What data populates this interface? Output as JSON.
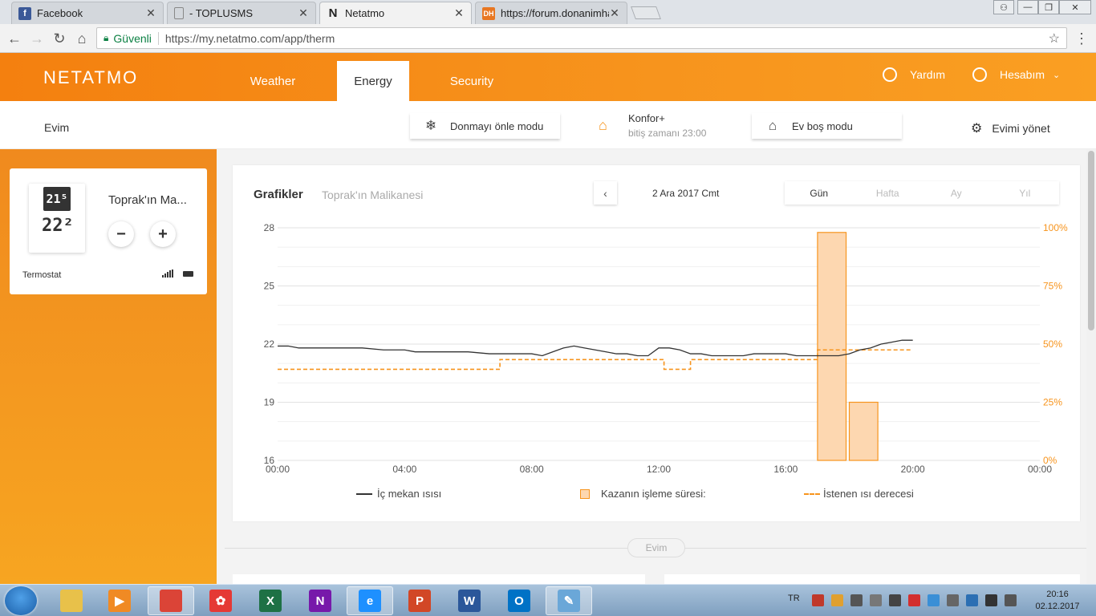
{
  "browser": {
    "tabs": [
      {
        "label": "Facebook",
        "favicon": "f",
        "color": "#3b5998"
      },
      {
        "label": "- TOPLUSMS",
        "favicon": "doc",
        "color": "#888888"
      },
      {
        "label": "Netatmo",
        "favicon": "N",
        "color": "#222222"
      },
      {
        "label": "https://forum.donanimha",
        "favicon": "DH",
        "color": "#e87722"
      }
    ],
    "active_tab": 2,
    "secure_label": "Güvenli",
    "url": "https://my.netatmo.com/app/therm"
  },
  "header": {
    "logo": "NETATMO",
    "nav": [
      "Weather",
      "Energy",
      "Security"
    ],
    "active_nav": 1,
    "help": "Yardım",
    "account": "Hesabım"
  },
  "modebar": {
    "home": "Evim",
    "frost_mode": "Donmayı önle modu",
    "comfort_title": "Konfor+",
    "comfort_sub": "bitiş zamanı 23:00",
    "away_mode": "Ev boş modu",
    "manage": "Evimi yönet"
  },
  "thermostat": {
    "current_temp": "21⁵",
    "set_temp": "22²",
    "room": "Toprak'ın Ma...",
    "device": "Termostat",
    "minus": "−",
    "plus": "+",
    "signal_level": 4
  },
  "graph": {
    "title": "Grafikler",
    "subtitle": "Toprak'ın Malikanesi",
    "date": "2 Ara 2017 Cmt",
    "ranges": [
      "Gün",
      "Hafta",
      "Ay",
      "Yıl"
    ],
    "selected_range": 0,
    "legend": [
      "İç mekan ısısı",
      "Kazanın işleme süresi:",
      "İstenen ısı derecesi"
    ],
    "footer_pill": "Evim"
  },
  "chart_data": {
    "type": "line",
    "x_ticks": [
      "00:00",
      "04:00",
      "08:00",
      "12:00",
      "16:00",
      "20:00",
      "00:00"
    ],
    "y_left_ticks": [
      28,
      25,
      22,
      19,
      16
    ],
    "y_right_ticks": [
      "100%",
      "75%",
      "50%",
      "25%",
      "0%"
    ],
    "y_left_range": [
      16,
      28
    ],
    "y_right_range": [
      0,
      100
    ],
    "colors": {
      "indoor": "#333333",
      "setpoint": "#f7941d",
      "boiler": "#f7941d"
    },
    "series": [
      {
        "name": "İç mekan ısısı",
        "x": [
          "00:00",
          "00:20",
          "00:40",
          "01:20",
          "02:00",
          "02:40",
          "03:20",
          "04:00",
          "04:20",
          "04:40",
          "05:20",
          "06:00",
          "06:40",
          "07:20",
          "08:00",
          "08:20",
          "08:40",
          "09:00",
          "09:20",
          "09:40",
          "10:00",
          "10:20",
          "10:40",
          "11:00",
          "11:20",
          "11:40",
          "12:00",
          "12:20",
          "12:40",
          "13:00",
          "13:20",
          "13:40",
          "14:00",
          "14:40",
          "15:00",
          "15:20",
          "15:40",
          "16:00",
          "16:20",
          "16:40",
          "17:00",
          "17:20",
          "17:40",
          "18:00",
          "18:20",
          "18:40",
          "19:00",
          "19:20",
          "19:40",
          "20:00"
        ],
        "values": [
          21.9,
          21.9,
          21.8,
          21.8,
          21.8,
          21.8,
          21.7,
          21.7,
          21.6,
          21.6,
          21.6,
          21.6,
          21.5,
          21.5,
          21.5,
          21.4,
          21.6,
          21.8,
          21.9,
          21.8,
          21.7,
          21.6,
          21.5,
          21.5,
          21.4,
          21.4,
          21.8,
          21.8,
          21.7,
          21.5,
          21.5,
          21.4,
          21.4,
          21.4,
          21.5,
          21.5,
          21.5,
          21.5,
          21.4,
          21.4,
          21.4,
          21.4,
          21.4,
          21.5,
          21.7,
          21.8,
          22.0,
          22.1,
          22.2,
          22.2
        ]
      },
      {
        "name": "İstenen ısı derecesi",
        "x": [
          "00:00",
          "07:00",
          "07:00",
          "12:10",
          "12:10",
          "13:00",
          "13:00",
          "17:00",
          "17:00",
          "20:00"
        ],
        "values": [
          20.7,
          20.7,
          21.2,
          21.2,
          20.7,
          20.7,
          21.2,
          21.2,
          21.7,
          21.7
        ]
      },
      {
        "name": "Kazanın işleme süresi:",
        "x": [
          "17:00",
          "18:00"
        ],
        "values": [
          98,
          25
        ],
        "kind": "bar_percent"
      }
    ]
  },
  "taskbar": {
    "apps": [
      {
        "name": "file-explorer",
        "color": "#e8c14a",
        "glyph": ""
      },
      {
        "name": "media-player",
        "color": "#f08a24",
        "glyph": "▶"
      },
      {
        "name": "chrome",
        "color": "#db4437",
        "glyph": "",
        "open": true
      },
      {
        "name": "photo-app",
        "color": "#e53935",
        "glyph": "✿"
      },
      {
        "name": "excel",
        "color": "#1e7145",
        "glyph": "X"
      },
      {
        "name": "onenote",
        "color": "#7719aa",
        "glyph": "N"
      },
      {
        "name": "internet-explorer",
        "color": "#1e90ff",
        "glyph": "e",
        "open": true
      },
      {
        "name": "powerpoint",
        "color": "#d24726",
        "glyph": "P"
      },
      {
        "name": "word",
        "color": "#2b579a",
        "glyph": "W"
      },
      {
        "name": "outlook",
        "color": "#0072c6",
        "glyph": "O"
      },
      {
        "name": "paint",
        "color": "#6aa7d8",
        "glyph": "✎",
        "open": true
      }
    ],
    "lang": "TR",
    "time": "20:16",
    "date": "02.12.2017"
  }
}
